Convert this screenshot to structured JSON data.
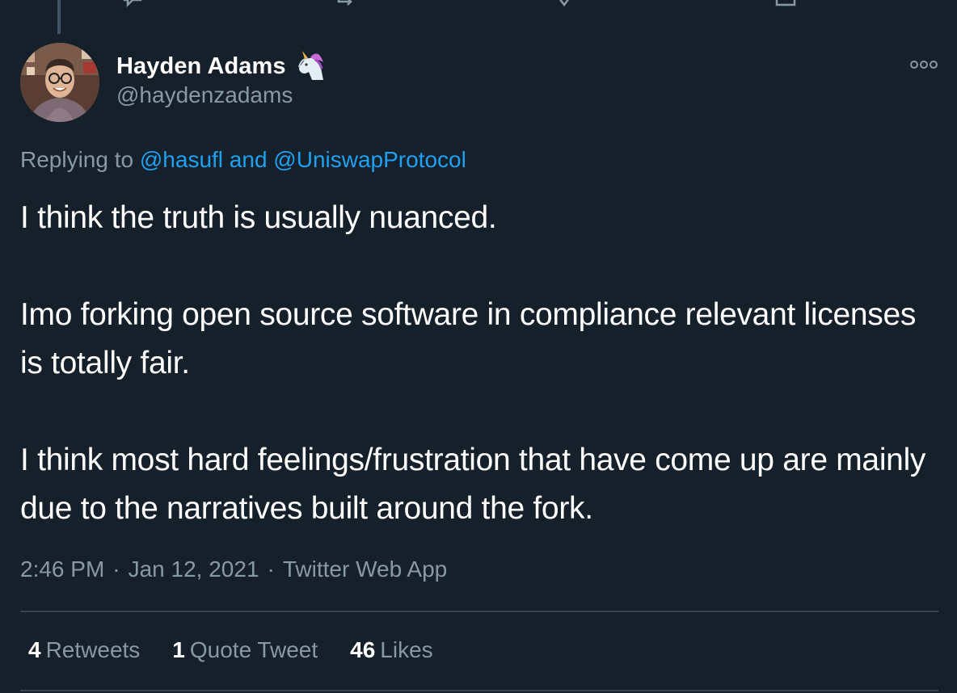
{
  "author": {
    "display_name": "Hayden Adams",
    "emoji": "unicorn-icon",
    "handle": "@haydenzadams"
  },
  "reply": {
    "prefix": "Replying to",
    "mention_1": "@hasufl",
    "conjunction": "and",
    "mention_2": "@UniswapProtocol"
  },
  "tweet": {
    "paragraphs": [
      "I think the truth is usually nuanced.",
      "Imo forking open source software in compliance relevant licenses is totally fair.",
      "I think most hard feelings/frustration that have come up are mainly due to the narratives built around the fork."
    ]
  },
  "meta": {
    "time": "2:46 PM",
    "date": "Jan 12, 2021",
    "source": "Twitter Web App",
    "separator": "·"
  },
  "stats": {
    "retweets_count": "4",
    "retweets_label": "Retweets",
    "quotes_count": "1",
    "quotes_label": "Quote Tweet",
    "likes_count": "46",
    "likes_label": "Likes"
  },
  "colors": {
    "background": "#15202b",
    "primary_text": "#ffffff",
    "secondary_text": "#8899a6",
    "link": "#1da1f2",
    "divider": "#38444d"
  }
}
